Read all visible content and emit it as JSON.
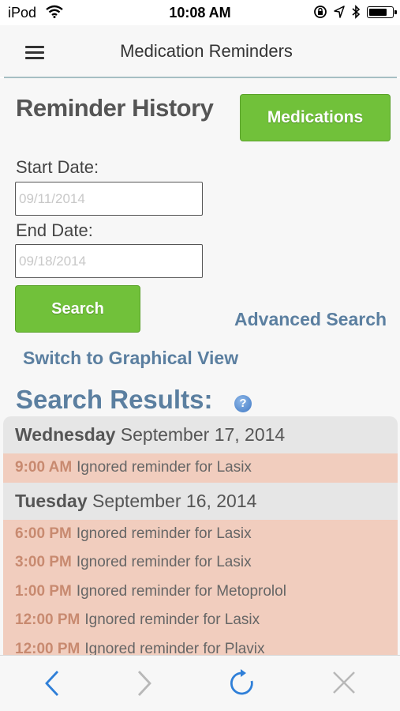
{
  "status": {
    "carrier": "iPod",
    "time": "10:08 AM",
    "battery_level": 0.8
  },
  "header": {
    "title": "Medication Reminders",
    "menu_icon": "hamburger-menu-icon"
  },
  "page": {
    "title": "Reminder History",
    "medications_button": "Medications",
    "start_label": "Start Date:",
    "start_placeholder": "09/11/2014",
    "end_label": "End Date:",
    "end_placeholder": "09/18/2014",
    "search_button": "Search",
    "advanced_search": "Advanced Search",
    "graphical_view": "Switch to Graphical View",
    "results_title": "Search Results:",
    "help_icon": "?"
  },
  "results": [
    {
      "weekday": "Wednesday",
      "date": "September 17, 2014",
      "reminders": [
        {
          "time": "9:00 AM",
          "text": "Ignored reminder for Lasix"
        }
      ]
    },
    {
      "weekday": "Tuesday",
      "date": "September 16, 2014",
      "reminders": [
        {
          "time": "6:00 PM",
          "text": "Ignored reminder for Lasix"
        },
        {
          "time": "3:00 PM",
          "text": "Ignored reminder for Lasix"
        },
        {
          "time": "1:00 PM",
          "text": "Ignored reminder for Metoprolol"
        },
        {
          "time": "12:00 PM",
          "text": "Ignored reminder for Lasix"
        },
        {
          "time": "12:00 PM",
          "text": "Ignored reminder for Plavix"
        }
      ]
    }
  ],
  "toolbar": {
    "icons": [
      "back-icon",
      "forward-icon",
      "refresh-icon",
      "stop-icon"
    ],
    "accent": "#2f7fd8",
    "disabled": "#b8b8b8"
  },
  "colors": {
    "green": "#71c13a",
    "link_blue": "#5b7fa0",
    "row_bg": "#f1cdbe",
    "header_bg": "#e6e6e6"
  }
}
